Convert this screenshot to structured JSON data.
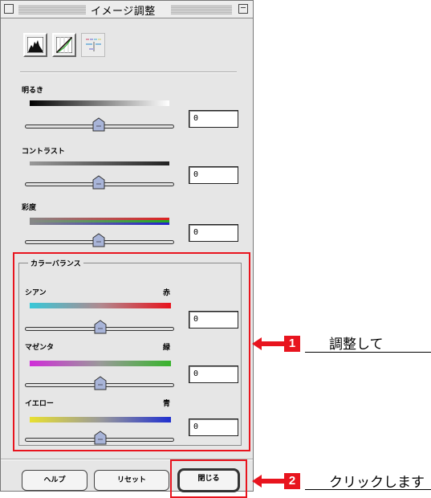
{
  "window": {
    "title": "イメージ調整"
  },
  "toolbar": {
    "icons": [
      "histogram-icon",
      "tone-curve-icon",
      "color-adjust-icon"
    ]
  },
  "sliders": {
    "brightness": {
      "label": "明るき",
      "value": "0"
    },
    "contrast": {
      "label": "コントラスト",
      "value": "0"
    },
    "saturation": {
      "label": "彩度",
      "value": "0"
    }
  },
  "color_balance": {
    "group_label": "カラーバランス",
    "cyan": {
      "left": "シアン",
      "right": "赤",
      "value": "0"
    },
    "magenta": {
      "left": "マゼンタ",
      "right": "緑",
      "value": "0"
    },
    "yellow": {
      "left": "イエロー",
      "right": "青",
      "value": "0"
    }
  },
  "buttons": {
    "help": "ヘルプ",
    "reset": "リセット",
    "close": "閉じる"
  },
  "callouts": [
    {
      "number": "1",
      "text": "調整して"
    },
    {
      "number": "2",
      "text": "クリックします"
    }
  ],
  "colors": {
    "highlight_red": "#e8141e",
    "window_bg": "#e6e6e6"
  }
}
